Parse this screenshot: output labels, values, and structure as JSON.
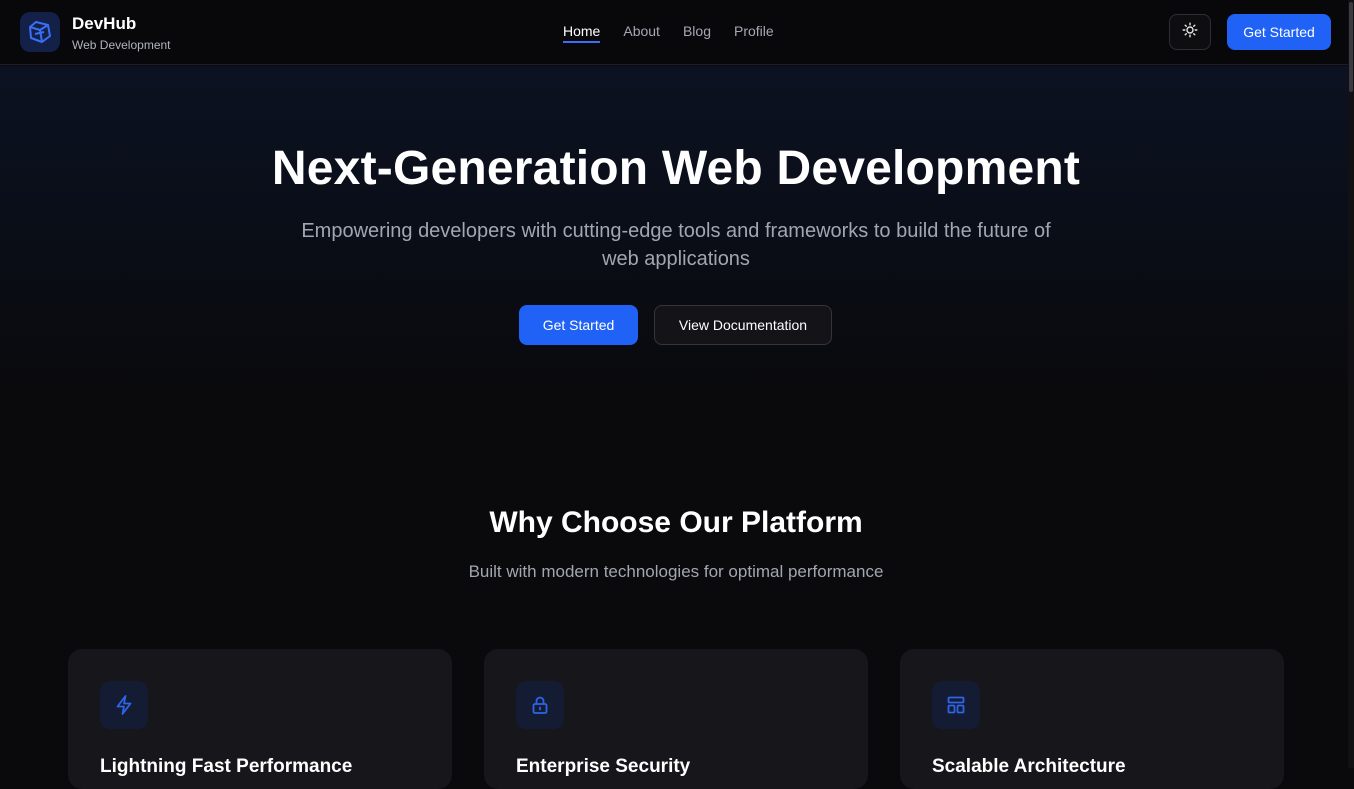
{
  "brand": {
    "name": "DevHub",
    "tagline": "Web Development"
  },
  "nav": {
    "links": [
      {
        "label": "Home",
        "active": true
      },
      {
        "label": "About",
        "active": false
      },
      {
        "label": "Blog",
        "active": false
      },
      {
        "label": "Profile",
        "active": false
      }
    ],
    "theme_icon": "sun-icon",
    "cta_label": "Get Started"
  },
  "hero": {
    "title": "Next-Generation Web Development",
    "subtitle": "Empowering developers with cutting-edge tools and frameworks to build the future of web applications",
    "primary_label": "Get Started",
    "secondary_label": "View Documentation"
  },
  "features": {
    "title": "Why Choose Our Platform",
    "subtitle": "Built with modern technologies for optimal performance",
    "cards": [
      {
        "icon": "lightning-icon",
        "title": "Lightning Fast Performance"
      },
      {
        "icon": "lock-icon",
        "title": "Enterprise Security"
      },
      {
        "icon": "layout-icon",
        "title": "Scalable Architecture"
      }
    ]
  },
  "colors": {
    "accent": "#1f62f5",
    "background": "#0a0a0c",
    "card": "#16161b",
    "muted_text": "#a2a6b0"
  }
}
